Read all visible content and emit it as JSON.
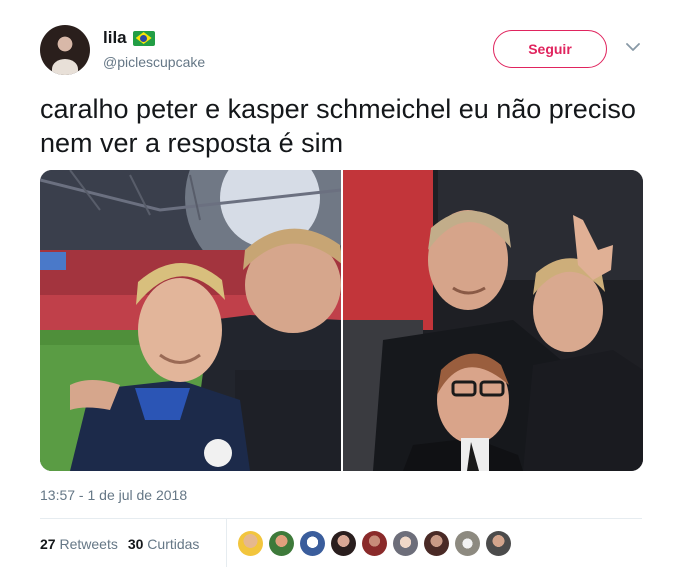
{
  "author": {
    "display_name": "lila",
    "flag_icon": "brazil-flag-icon",
    "handle": "@piclescupcake"
  },
  "follow_label": "Seguir",
  "menu_icon": "chevron-down-icon",
  "tweet": {
    "text": "caralho peter e kasper schmeichel eu não preciso nem ver a resposta é sim"
  },
  "timestamp": "13:57 - 1 de jul de 2018",
  "stats": {
    "retweets_count": "27",
    "retweets_label": "Retweets",
    "likes_count": "30",
    "likes_label": "Curtidas"
  },
  "colors": {
    "accent": "#e0245e",
    "text": "#14171a",
    "muted": "#657786",
    "divider": "#e6ecf0"
  }
}
